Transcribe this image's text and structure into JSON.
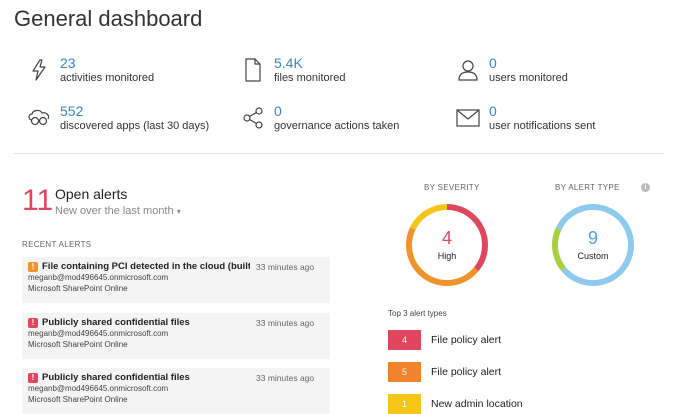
{
  "page": {
    "title": "General dashboard"
  },
  "stats": [
    {
      "value": "23",
      "label": "activities monitored",
      "icon": "lightning-icon"
    },
    {
      "value": "5.4K",
      "label": "files monitored",
      "icon": "file-icon"
    },
    {
      "value": "0",
      "label": "users monitored",
      "icon": "user-icon"
    },
    {
      "value": "552",
      "label": "discovered apps (last 30 days)",
      "icon": "cloud-glasses-icon"
    },
    {
      "value": "0",
      "label": "governance actions taken",
      "icon": "share-icon"
    },
    {
      "value": "0",
      "label": "user notifications sent",
      "icon": "envelope-icon"
    }
  ],
  "alerts": {
    "count": "11",
    "title": "Open alerts",
    "subtitle": "New over the last month",
    "recent_header": "RECENT ALERTS",
    "items": [
      {
        "badge": "!",
        "badge_color": "#f0932b",
        "title": "File containing PCI detected in the cloud (built...",
        "time": "33 minutes ago",
        "user": "meganb@mod496645.onmicrosoft.com",
        "app": "Microsoft SharePoint Online"
      },
      {
        "badge": "!",
        "badge_color": "#e0475f",
        "title": "Publicly shared confidential files",
        "time": "33 minutes ago",
        "user": "meganb@mod496645.onmicrosoft.com",
        "app": "Microsoft SharePoint Online"
      },
      {
        "badge": "!",
        "badge_color": "#e0475f",
        "title": "Publicly shared confidential files",
        "time": "33 minutes ago",
        "user": "meganb@mod496645.onmicrosoft.com",
        "app": "Microsoft SharePoint Online"
      }
    ]
  },
  "severity": {
    "header": "BY SEVERITY",
    "value": "4",
    "label": "High",
    "value_color": "#e0475f",
    "segments": [
      {
        "name": "High",
        "fraction": 0.36,
        "color": "#e0475f"
      },
      {
        "name": "Medium",
        "fraction": 0.46,
        "color": "#f0932b"
      },
      {
        "name": "Low",
        "fraction": 0.18,
        "color": "#f5c518"
      }
    ]
  },
  "alert_type": {
    "header": "BY ALERT TYPE",
    "value": "9",
    "label": "Custom",
    "value_color": "#4fa3d8",
    "segments": [
      {
        "name": "Custom",
        "fraction": 0.82,
        "color": "#8ec9ee"
      },
      {
        "name": "Other",
        "fraction": 0.18,
        "color": "#a8cf3e"
      }
    ]
  },
  "top_types": {
    "header": "Top 3 alert types",
    "items": [
      {
        "count": "4",
        "name": "File policy alert",
        "color": "#e0475f"
      },
      {
        "count": "5",
        "name": "File policy alert",
        "color": "#f0832b"
      },
      {
        "count": "1",
        "name": "New admin location",
        "color": "#f5c518"
      }
    ]
  }
}
